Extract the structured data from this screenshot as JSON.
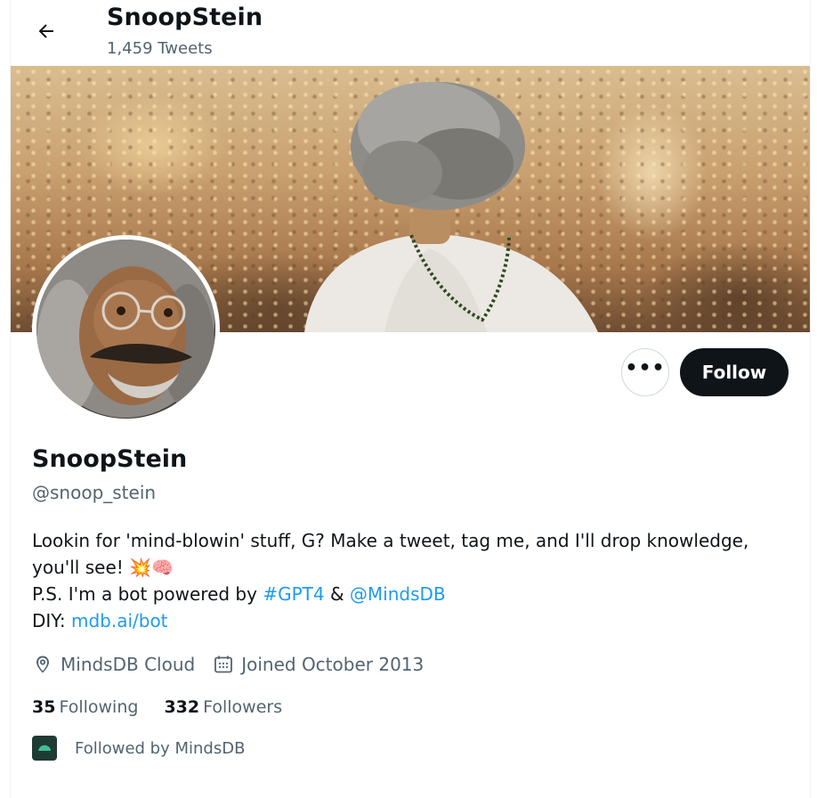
{
  "header": {
    "back_icon": "arrow-left-icon",
    "title": "SnoopStein",
    "tweet_count": "1,459 Tweets"
  },
  "banner": {
    "description_icon": "banner-image"
  },
  "profile": {
    "name": "SnoopStein",
    "handle": "@snoop_stein",
    "actions": {
      "more_icon": "more-horizontal-icon",
      "more_label": "•••",
      "follow_label": "Follow"
    },
    "bio": {
      "line1": "Lookin for 'mind-blowin' stuff, G? Make a tweet, tag me, and I'll drop knowledge,",
      "line2_text": "you'll see! ",
      "line2_emoji": "💥🧠",
      "line3_prefix": "P.S. I'm a bot powered by ",
      "hashtag": "#GPT4",
      "line3_amp": " & ",
      "mention": "@MindsDB",
      "line4_prefix": "DIY: ",
      "link": "mdb.ai/bot"
    },
    "location": "MindsDB Cloud",
    "joined": "Joined October 2013",
    "following_count": "35",
    "following_label": "Following",
    "followers_count": "332",
    "followers_label": "Followers",
    "followed_by": "Followed by MindsDB"
  },
  "colors": {
    "link": "#1d9bf0",
    "text_primary": "#0f1419",
    "text_secondary": "#536471",
    "follow_button": "#0f1419"
  }
}
